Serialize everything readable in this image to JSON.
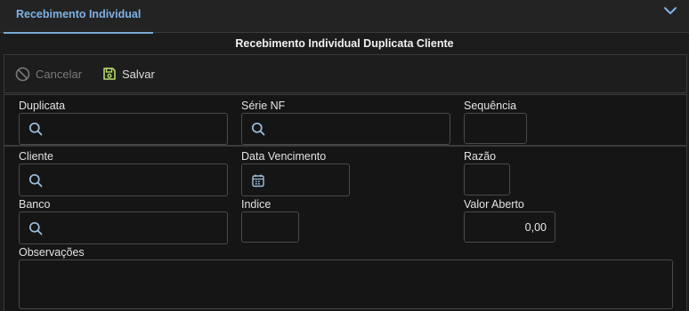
{
  "tab": {
    "label": "Recebimento Individual",
    "active": true
  },
  "form_title": "Recebimento Individual Duplicata Cliente",
  "toolbar": {
    "cancel_label": "Cancelar",
    "save_label": "Salvar"
  },
  "fields": {
    "duplicata": {
      "label": "Duplicata",
      "value": ""
    },
    "serie_nf": {
      "label": "Série NF",
      "value": ""
    },
    "sequencia": {
      "label": "Sequência",
      "value": ""
    },
    "cliente": {
      "label": "Cliente",
      "value": ""
    },
    "data_vencimento": {
      "label": "Data Vencimento",
      "value": ""
    },
    "razao": {
      "label": "Razão",
      "value": ""
    },
    "banco": {
      "label": "Banco",
      "value": ""
    },
    "indice": {
      "label": "Indice",
      "value": ""
    },
    "valor_aberto": {
      "label": "Valor Aberto",
      "value": "0,00"
    },
    "observacoes": {
      "label": "Observações",
      "value": ""
    }
  },
  "icons": {
    "collapse": "chevron-down-icon",
    "cancel": "cancel-circle-icon",
    "save": "save-icon",
    "lookup": "search-icon",
    "date": "calendar-icon"
  },
  "colors": {
    "accent": "#7fb2e6",
    "save_icon": "#b8d96a",
    "background": "#1c1c1c",
    "panel": "#151515"
  }
}
